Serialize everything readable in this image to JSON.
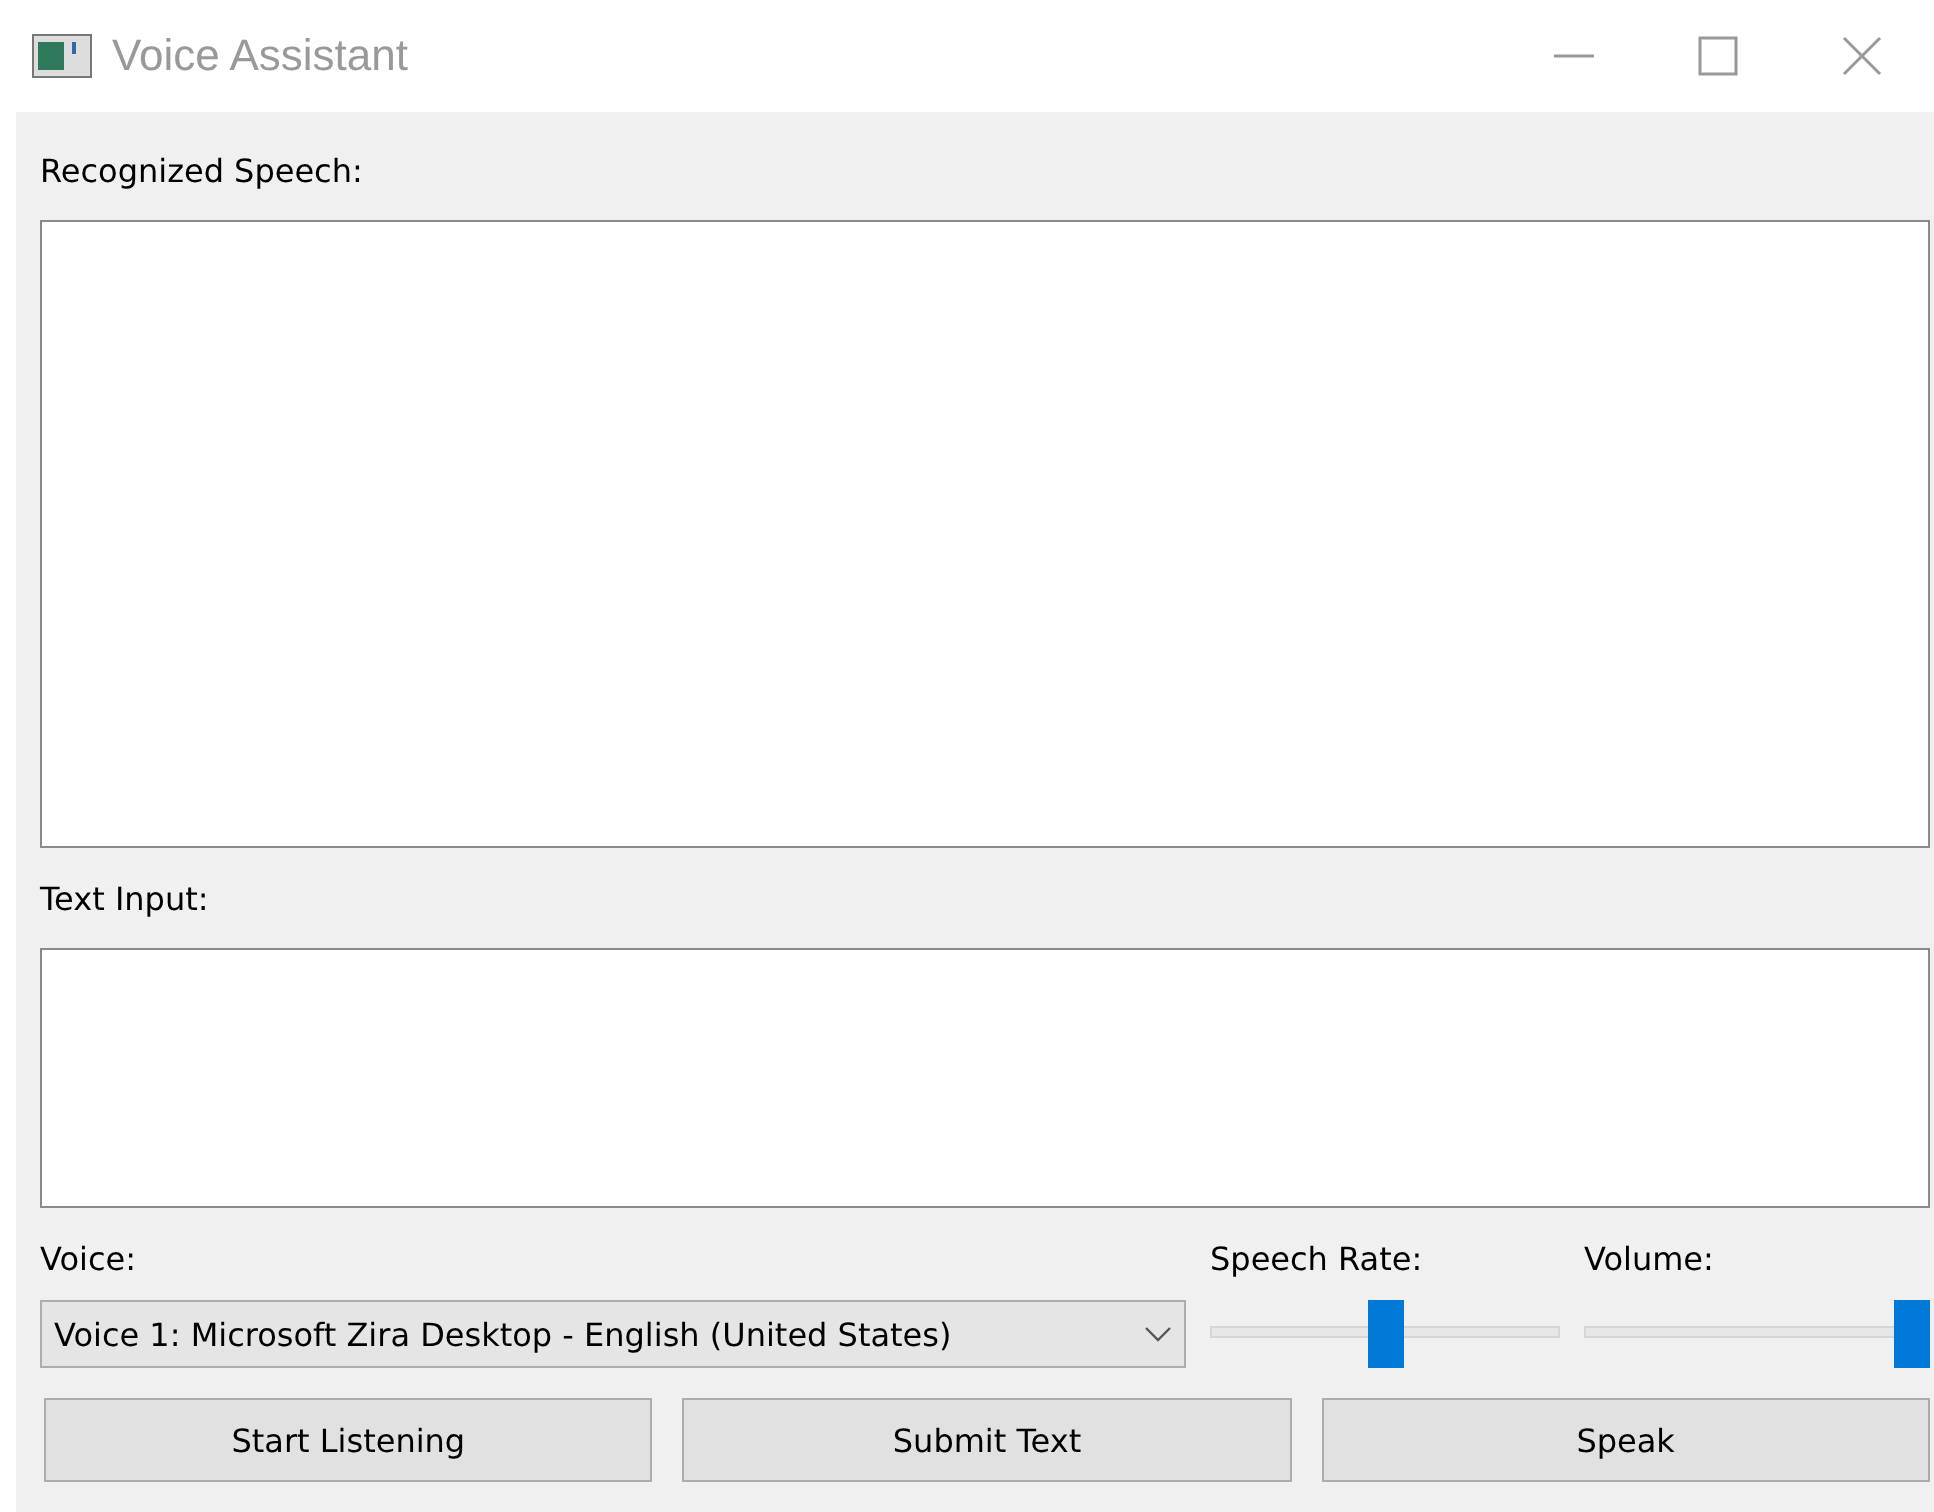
{
  "window": {
    "title": "Voice Assistant"
  },
  "recognized_speech": {
    "label": "Recognized Speech:"
  },
  "text_input": {
    "label": "Text Input:"
  },
  "voice": {
    "label": "Voice:",
    "value": "Voice 1: Microsoft Zira Desktop - English (United States)"
  },
  "sliders": [
    {
      "label": "Speech Rate:",
      "level": 0.5
    },
    {
      "label": "Volume:",
      "level": 1.0
    }
  ],
  "buttons": [
    "Start Listening",
    "Submit Text",
    "Speak"
  ]
}
